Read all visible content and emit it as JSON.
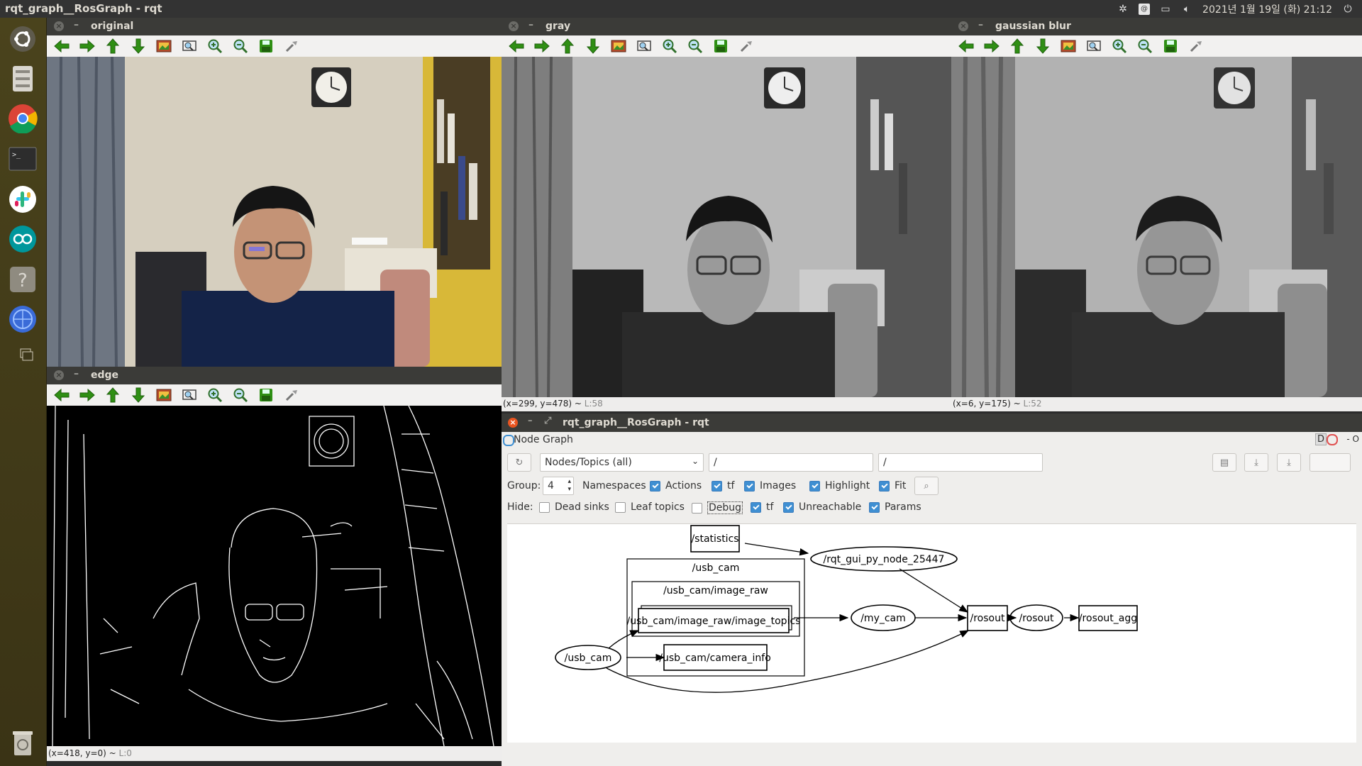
{
  "topbar": {
    "title": "rqt_graph__RosGraph - rqt",
    "datetime": "2021년 1월 19일 (화) 21:12",
    "icons": [
      "slack-tray-icon",
      "keyboard-icon",
      "display-icon",
      "volume-icon",
      "power-icon"
    ]
  },
  "launcher": {
    "items": [
      "ubuntu-icon",
      "files-icon",
      "chrome-icon",
      "terminal-icon",
      "slack-icon",
      "arduino-icon",
      "help-icon",
      "network-app-icon",
      "workspace-icon"
    ],
    "trash": "trash-icon"
  },
  "windows": {
    "original": {
      "title": "original",
      "status": ""
    },
    "gray": {
      "title": "gray",
      "status": "(x=299, y=478) ~ ",
      "level": "L:58"
    },
    "gaussian": {
      "title": "gaussian blur",
      "status": "(x=6, y=175) ~ ",
      "level": "L:52"
    },
    "edge": {
      "title": "edge",
      "status": "(x=418, y=0) ~ ",
      "level": "L:0"
    }
  },
  "toolbar_icons": [
    "pan-left-icon",
    "pan-right-icon",
    "pan-up-icon",
    "pan-down-icon",
    "zoom-original-icon",
    "zoom-fit-icon",
    "zoom-in-icon",
    "zoom-out-icon",
    "save-icon",
    "properties-icon"
  ],
  "rqt": {
    "title": "rqt_graph__RosGraph - rqt",
    "plugin": "Node Graph",
    "right_badge": "D",
    "right_ctrls": "- O",
    "filter_mode": "Nodes/Topics (all)",
    "ns_filter": "/",
    "topic_filter": "/",
    "group_label": "Group:",
    "group_value": "4",
    "row2": [
      {
        "label": "Namespaces",
        "checked": false
      },
      {
        "label": "Actions",
        "checked": true
      },
      {
        "label": "tf",
        "checked": true
      },
      {
        "label": "Images",
        "checked": true
      },
      {
        "label": "Highlight",
        "checked": true
      },
      {
        "label": "Fit",
        "checked": true
      }
    ],
    "hide_label": "Hide:",
    "row3": [
      {
        "label": "Dead sinks",
        "checked": false
      },
      {
        "label": "Leaf topics",
        "checked": false
      },
      {
        "label": "Debug",
        "checked": false
      },
      {
        "label": "tf",
        "checked": true
      },
      {
        "label": "Unreachable",
        "checked": true
      },
      {
        "label": "Params",
        "checked": true
      }
    ]
  },
  "graph": {
    "nodes": [
      "/statistics",
      "/rqt_gui_py_node_25447",
      "/usb_cam",
      "/usb_cam/image_raw",
      "/usb_cam/image_raw/image_topics",
      "/my_cam",
      "/rosout",
      "/rosout",
      "/rosout_agg",
      "/usb_cam",
      "/usb_cam/camera_info"
    ]
  },
  "colors": {
    "topbar": "#333333",
    "launcher": "#4a431c",
    "window_title": "#3b3b38",
    "close_active": "#e95420",
    "checkbox": "#3f8fd2"
  }
}
